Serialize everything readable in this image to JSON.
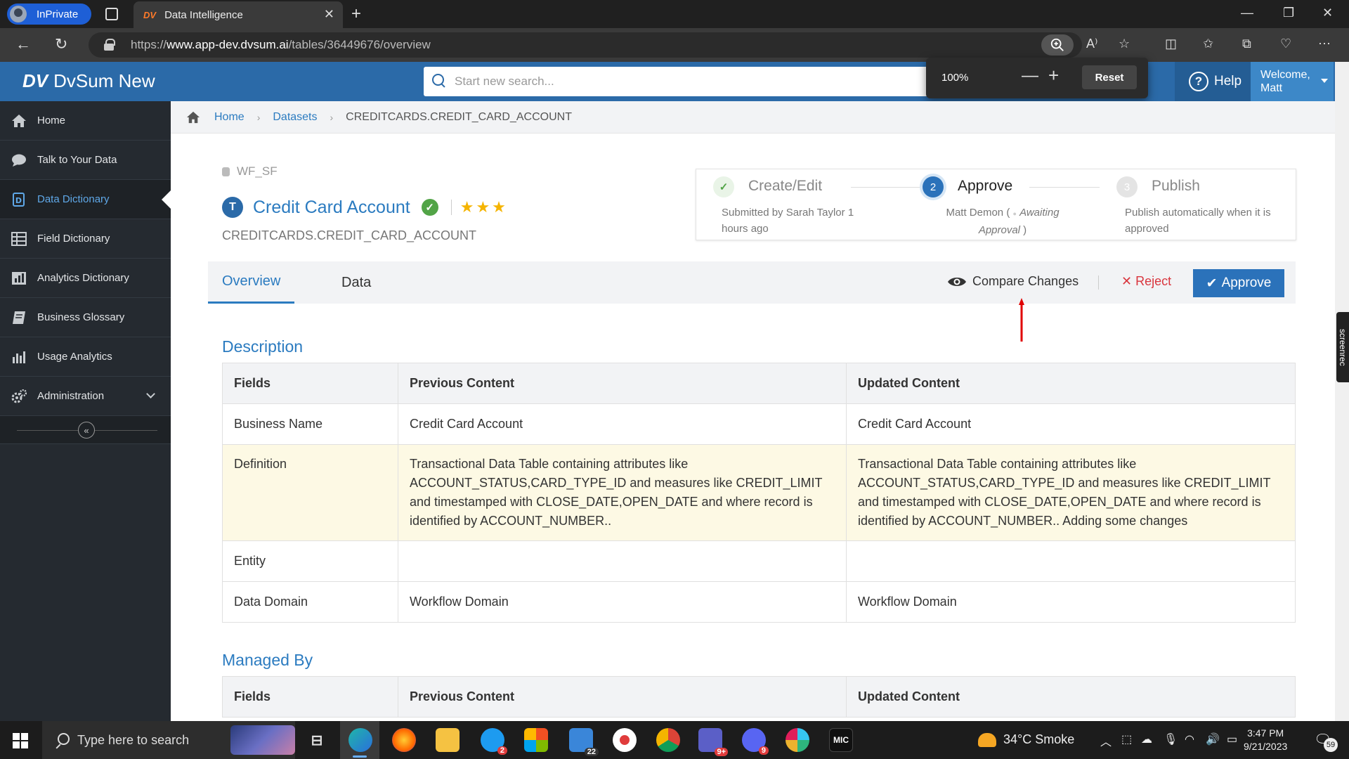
{
  "browser": {
    "inprivate_label": "InPrivate",
    "tab_title": "Data Intelligence",
    "tab_favicon": "DV",
    "url_scheme": "https://",
    "url_host": "www.app-dev.dvsum.ai",
    "url_path": "/tables/36449676/overview"
  },
  "zoom_popup": {
    "percent": "100%",
    "reset_label": "Reset"
  },
  "header": {
    "brand_mark": "DV",
    "brand_name": "DvSum New",
    "search_placeholder": "Start new search...",
    "help_label": "Help",
    "welcome_line1": "Welcome,",
    "welcome_line2": "Matt"
  },
  "sidebar": {
    "items": [
      {
        "label": "Home",
        "icon": "home-icon"
      },
      {
        "label": "Talk to Your Data",
        "icon": "chat-icon"
      },
      {
        "label": "Data Dictionary",
        "icon": "dictionary-icon",
        "active": true
      },
      {
        "label": "Field Dictionary",
        "icon": "grid-icon"
      },
      {
        "label": "Analytics Dictionary",
        "icon": "chart-icon"
      },
      {
        "label": "Business Glossary",
        "icon": "book-icon"
      },
      {
        "label": "Usage Analytics",
        "icon": "bars-icon"
      },
      {
        "label": "Administration",
        "icon": "gears-icon"
      }
    ]
  },
  "breadcrumb": {
    "home": "Home",
    "datasets": "Datasets",
    "current": "CREDITCARDS.CREDIT_CARD_ACCOUNT"
  },
  "asset": {
    "domain": "WF_SF",
    "type_badge": "T",
    "title": "Credit Card Account",
    "stars": "★★★",
    "technical_name": "CREDITCARDS.CREDIT_CARD_ACCOUNT"
  },
  "workflow": {
    "step1": {
      "name": "Create/Edit",
      "sub": "Submitted by Sarah Taylor 1 hours ago",
      "symbol": "✓"
    },
    "step2": {
      "number": "2",
      "name": "Approve",
      "person": "Matt Demon",
      "status": "Awaiting Approval"
    },
    "step3": {
      "number": "3",
      "name": "Publish",
      "sub": "Publish automatically when it is approved"
    }
  },
  "tabs": {
    "overview": "Overview",
    "data": "Data",
    "compare": "Compare Changes",
    "reject": "Reject",
    "approve": "Approve"
  },
  "description": {
    "heading": "Description",
    "headers": [
      "Fields",
      "Previous Content",
      "Updated Content"
    ],
    "rows": [
      {
        "field": "Business Name",
        "prev": "Credit Card Account",
        "updated": "Credit Card Account"
      },
      {
        "field": "Definition",
        "prev": "Transactional Data Table containing attributes like ACCOUNT_STATUS,CARD_TYPE_ID and measures like CREDIT_LIMIT and timestamped with CLOSE_DATE,OPEN_DATE and where record is identified by ACCOUNT_NUMBER..",
        "updated": "Transactional Data Table containing attributes like ACCOUNT_STATUS,CARD_TYPE_ID and measures like CREDIT_LIMIT and timestamped with CLOSE_DATE,OPEN_DATE and where record is identified by ACCOUNT_NUMBER.. Adding some changes"
      },
      {
        "field": "Entity",
        "prev": "",
        "updated": ""
      },
      {
        "field": "Data Domain",
        "prev": "Workflow Domain",
        "updated": "Workflow Domain"
      }
    ]
  },
  "managed_by": {
    "heading": "Managed By",
    "headers": [
      "Fields",
      "Previous Content",
      "Updated Content"
    ]
  },
  "taskbar": {
    "search_placeholder": "Type here to search",
    "weather": "34°C  Smoke",
    "time": "3:47 PM",
    "date": "9/21/2023",
    "notif_count": "59",
    "badge_skype": "2",
    "badge_mail": "22",
    "badge_teams": "9+",
    "badge_discord": "9"
  },
  "colors": {
    "brand": "#2b6aa8",
    "accent": "#2b7bc0",
    "sidebar": "#252a30",
    "approve": "#2b72ba",
    "reject": "#d9363e",
    "changed_row": "#fdf9e4"
  }
}
